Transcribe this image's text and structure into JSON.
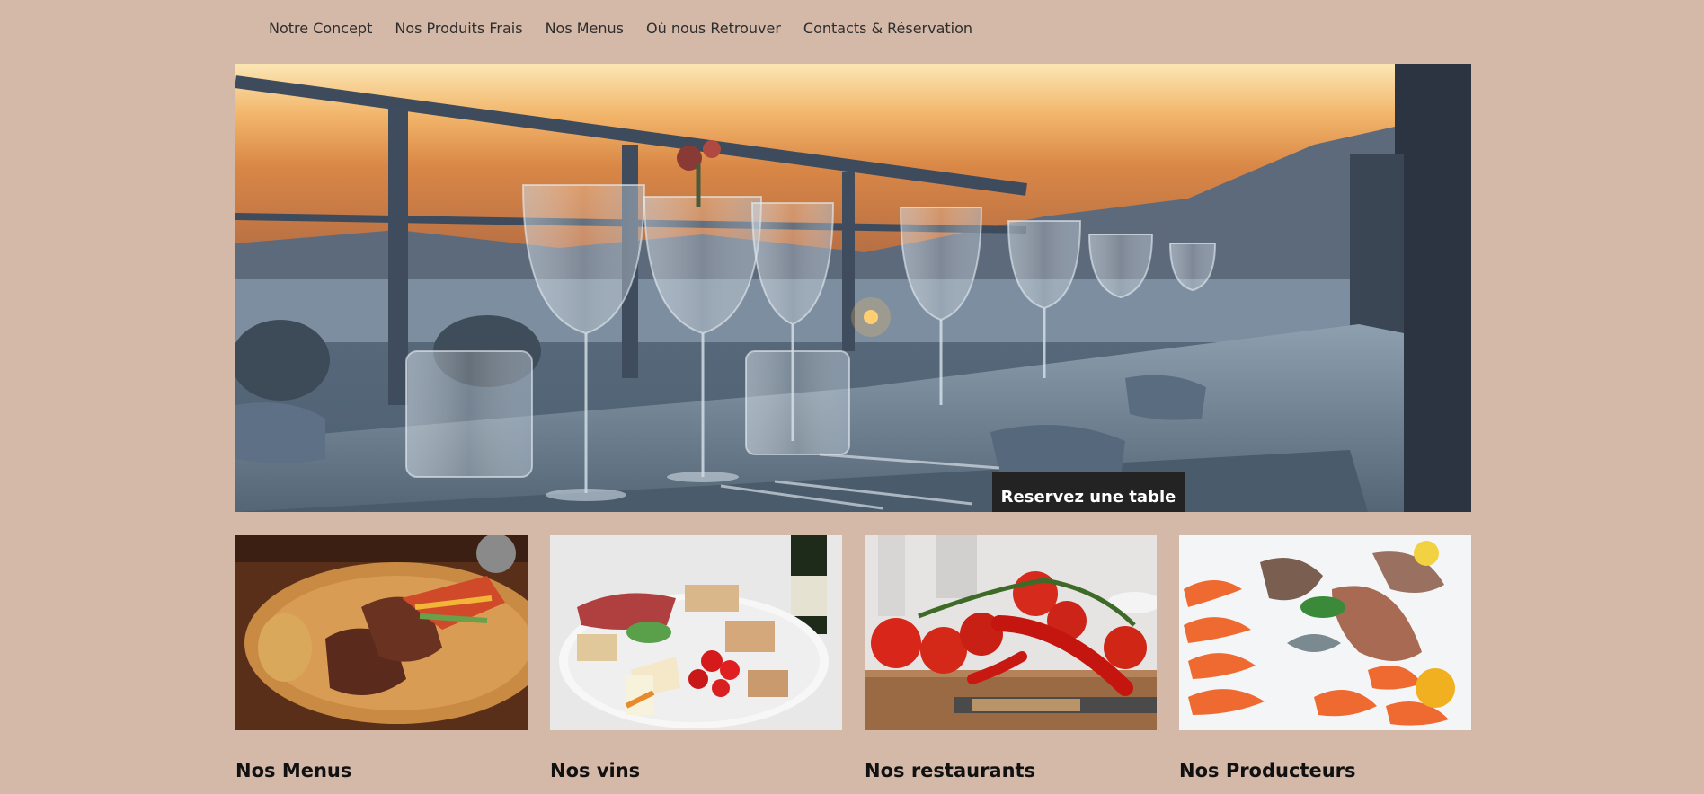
{
  "nav": {
    "items": [
      {
        "label": "Notre Concept"
      },
      {
        "label": "Nos Produits Frais"
      },
      {
        "label": "Nos Menus"
      },
      {
        "label": "Où nous Retrouver"
      },
      {
        "label": "Contacts & Réservation"
      }
    ]
  },
  "hero": {
    "cta_label": "Reservez une table"
  },
  "cards": [
    {
      "title": "Nos Menus"
    },
    {
      "title": "Nos vins"
    },
    {
      "title": "Nos restaurants"
    },
    {
      "title": "Nos Producteurs"
    }
  ],
  "colors": {
    "background": "#d4b8a8",
    "cta_bg": "#232323",
    "cta_text": "#ffffff"
  }
}
